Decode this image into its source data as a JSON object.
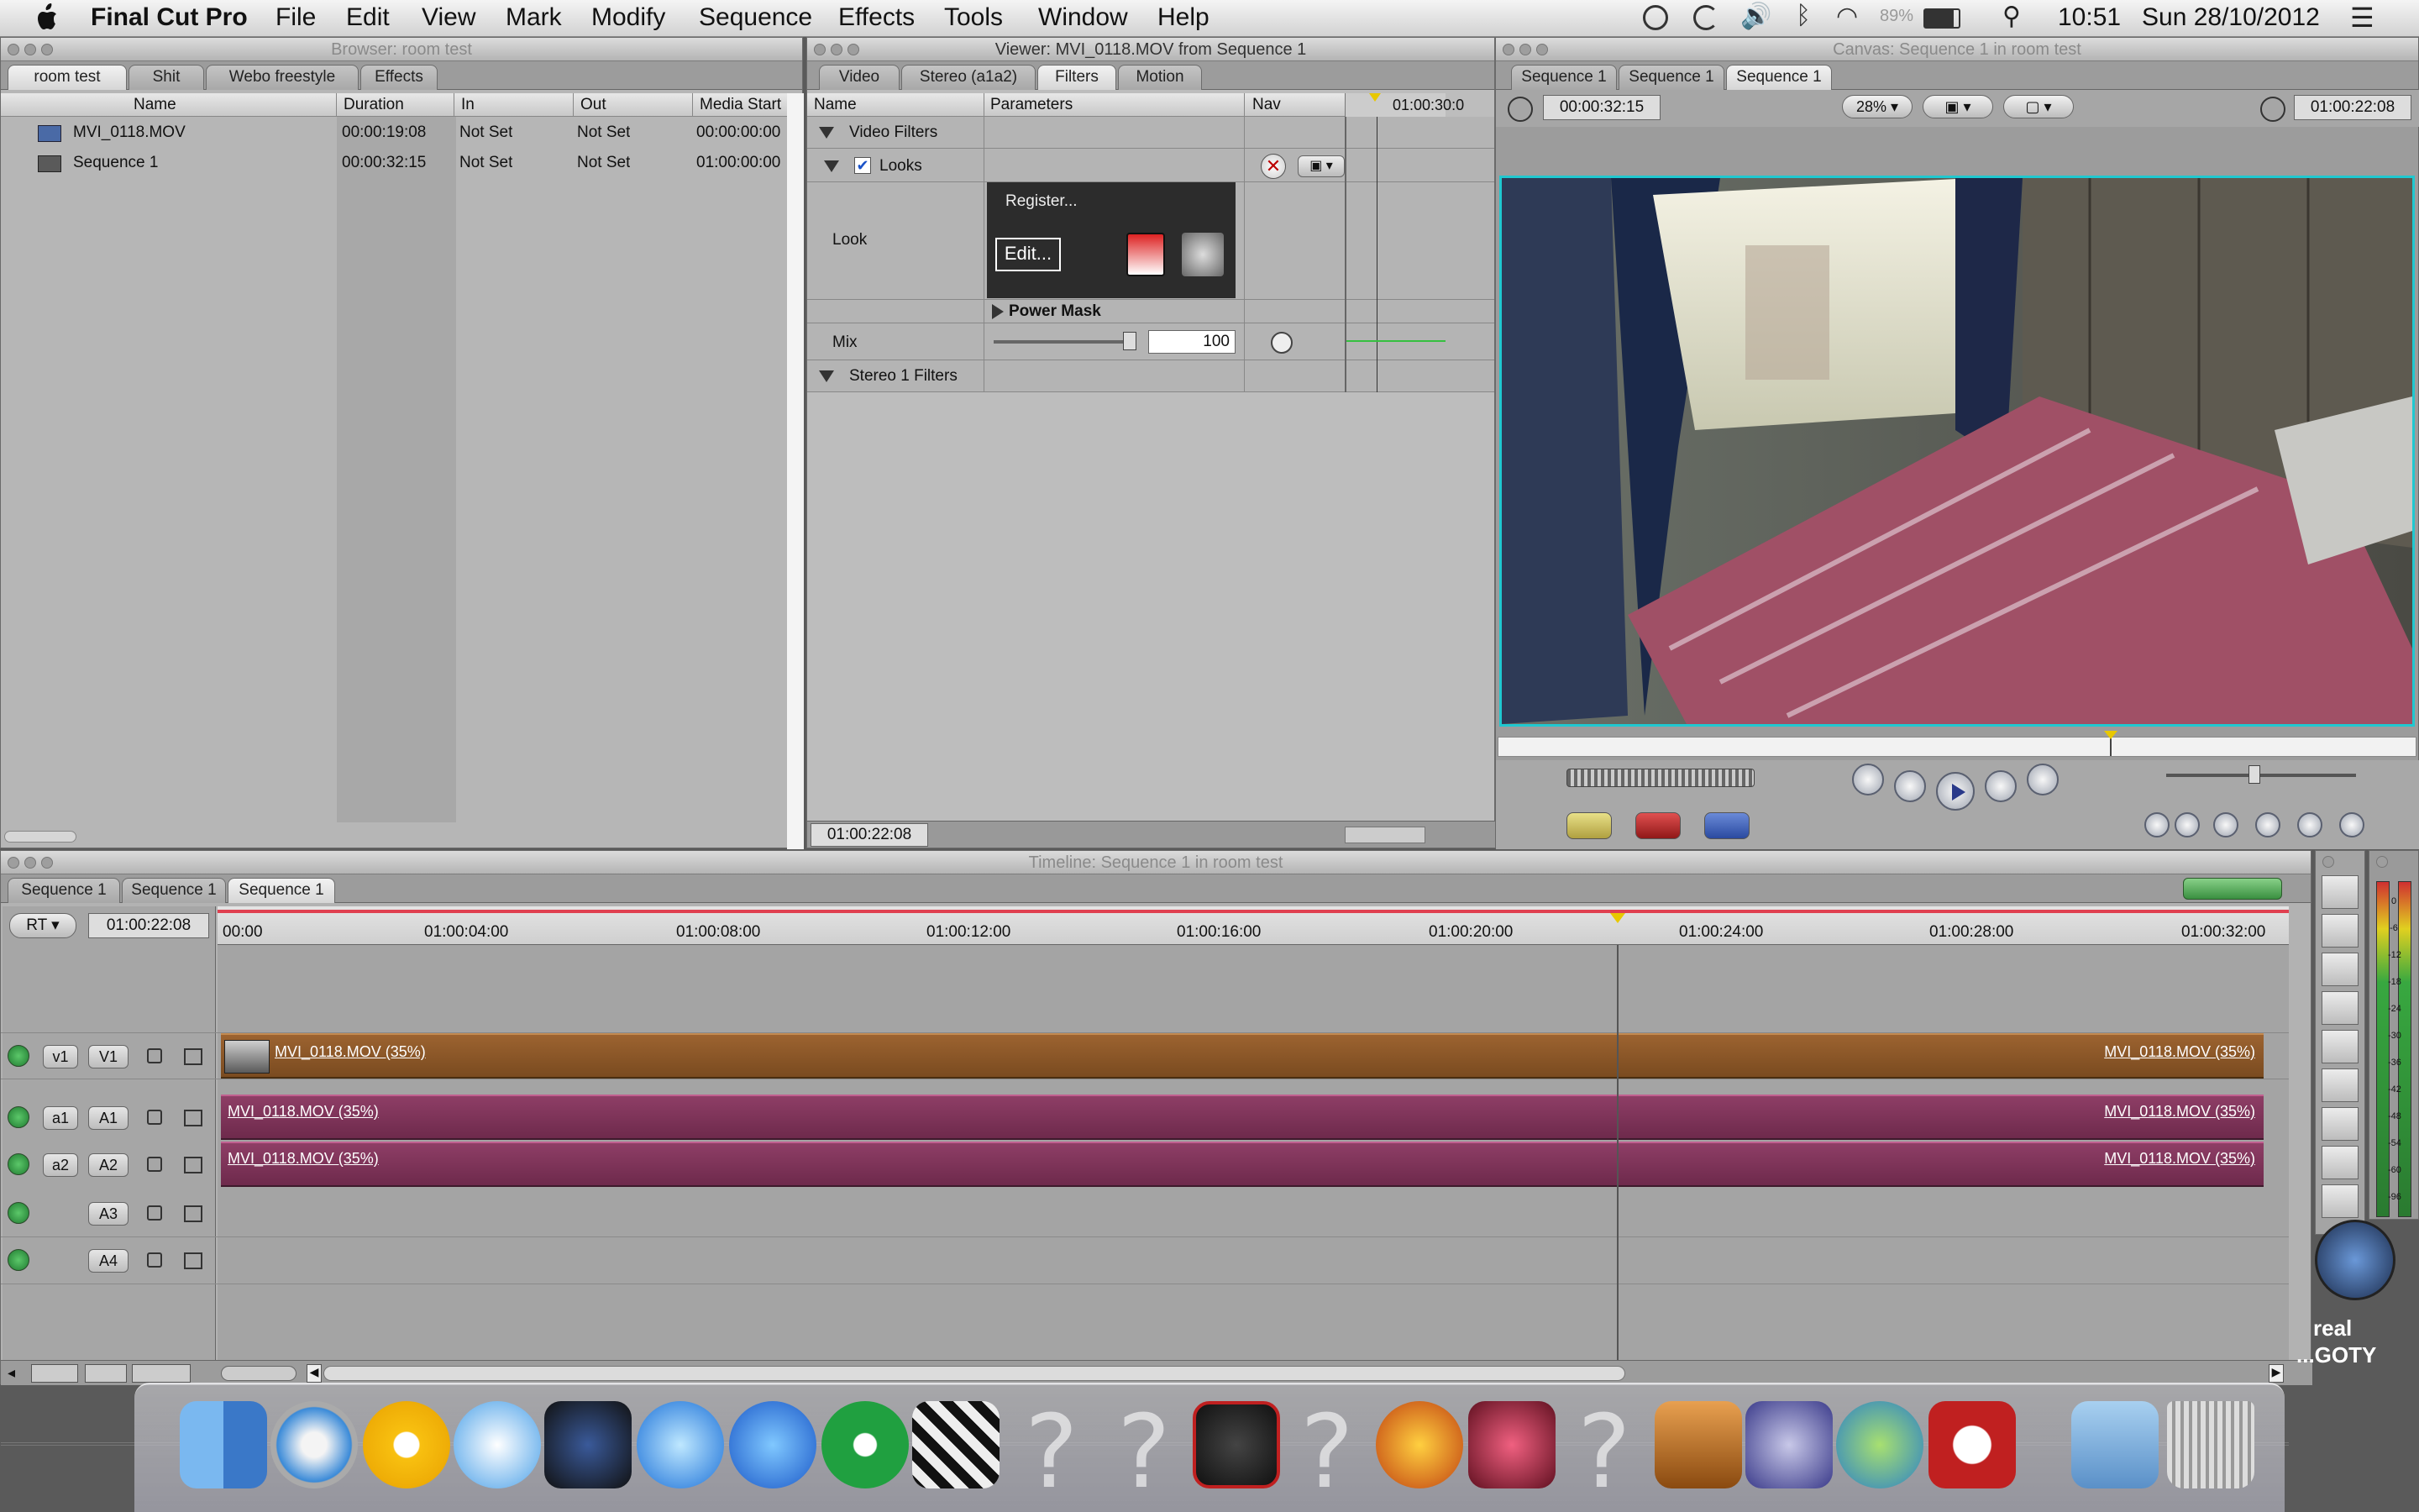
{
  "menubar": {
    "app": "Final Cut Pro",
    "items": [
      "File",
      "Edit",
      "View",
      "Mark",
      "Modify",
      "Sequence",
      "Effects",
      "Tools",
      "Window",
      "Help"
    ],
    "battery": "89%",
    "clock": "10:51",
    "date": "Sun 28/10/2012"
  },
  "browser": {
    "title": "Browser: room test",
    "tabs": [
      "room test",
      "Shit",
      "Webo freestyle",
      "Effects"
    ],
    "columns": [
      "Name",
      "Duration",
      "In",
      "Out",
      "Media Start"
    ],
    "rows": [
      {
        "name": "MVI_0118.MOV",
        "duration": "00:00:19:08",
        "in": "Not Set",
        "out": "Not Set",
        "media_start": "00:00:00:00"
      },
      {
        "name": "Sequence 1",
        "duration": "00:00:32:15",
        "in": "Not Set",
        "out": "Not Set",
        "media_start": "01:00:00:00"
      }
    ]
  },
  "viewer": {
    "title": "Viewer: MVI_0118.MOV from Sequence 1",
    "tabs": [
      "Video",
      "Stereo (a1a2)",
      "Filters",
      "Motion"
    ],
    "columns": [
      "Name",
      "Parameters",
      "Nav"
    ],
    "ruler_time": "01:00:30:0",
    "video_filters": "Video Filters",
    "looks": "Looks",
    "look_label": "Look",
    "register": "Register...",
    "edit": "Edit...",
    "power_mask": "Power Mask",
    "mix_label": "Mix",
    "mix_value": "100",
    "stereo_filters": "Stereo 1 Filters",
    "timecode": "01:00:22:08"
  },
  "canvas": {
    "title": "Canvas: Sequence 1 in room test",
    "tabs": [
      "Sequence 1",
      "Sequence 1",
      "Sequence 1"
    ],
    "duration": "00:00:32:15",
    "zoom": "28%",
    "timecode": "01:00:22:08"
  },
  "timeline": {
    "title": "Timeline: Sequence 1 in room test",
    "tabs": [
      "Sequence 1",
      "Sequence 1",
      "Sequence 1"
    ],
    "rt": "RT",
    "timecode": "01:00:22:08",
    "ruler": [
      "00:00",
      "01:00:04:00",
      "01:00:08:00",
      "01:00:12:00",
      "01:00:16:00",
      "01:00:20:00",
      "01:00:24:00",
      "01:00:28:00",
      "01:00:32:00"
    ],
    "tracks": {
      "v1_src": "v1",
      "v1_dst": "V1",
      "a1_src": "a1",
      "a1_dst": "A1",
      "a2_src": "a2",
      "a2_dst": "A2",
      "a3_dst": "A3",
      "a4_dst": "A4"
    },
    "clip_label": "MVI_0118.MOV (35%)"
  },
  "meter": [
    "0",
    "-6",
    "-12",
    "-18",
    "-24",
    "-30",
    "-36",
    "-42",
    "-48",
    "-54",
    "-60",
    "-96"
  ],
  "dock_label": {
    "line1": "real",
    "line2": "...GOTY"
  },
  "colors": {
    "video_clip": "#8a5628",
    "audio_clip": "#7e3358",
    "playhead": "#e8c800",
    "canvas_border": "#20c8d0"
  }
}
